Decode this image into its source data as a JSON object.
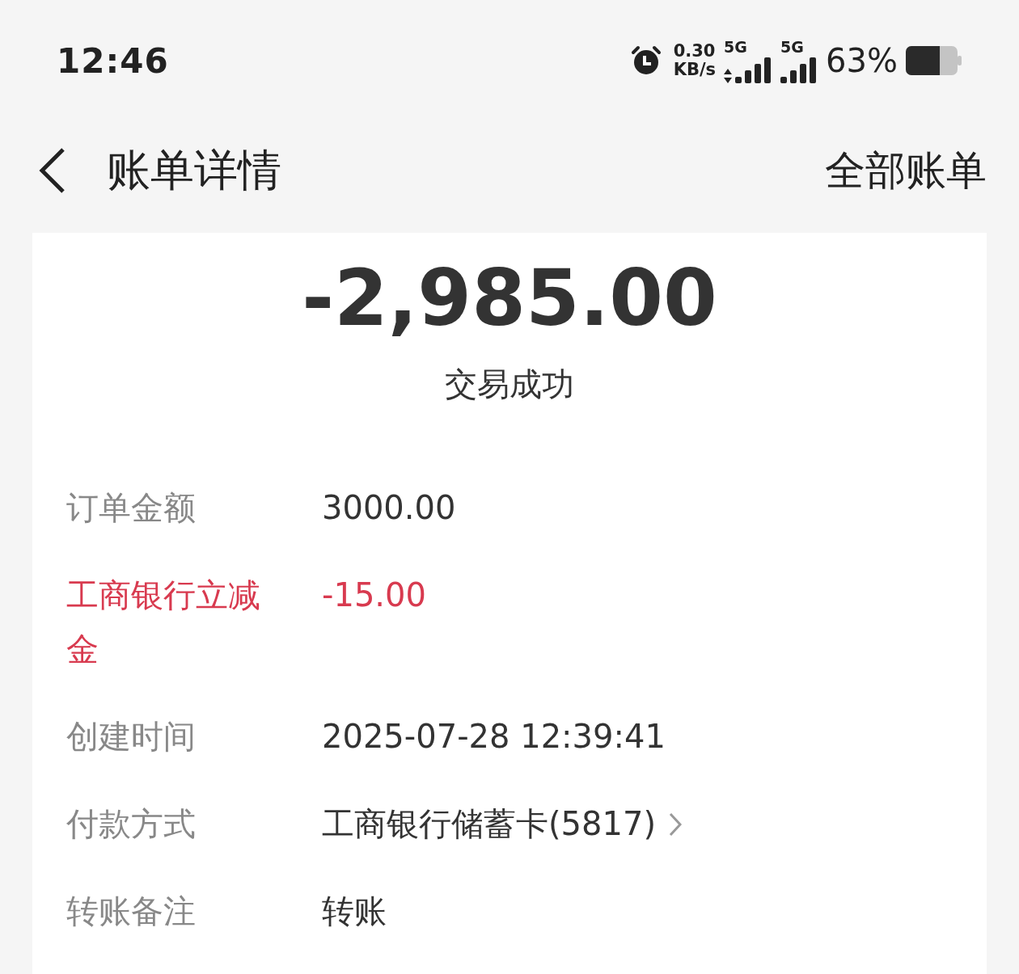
{
  "status_bar": {
    "time": "12:46",
    "net_speed": [
      "0.30",
      "KB/s"
    ],
    "network_labels": [
      "5G",
      "5G"
    ],
    "battery": "63%"
  },
  "header": {
    "title": "账单详情",
    "action": "全部账单"
  },
  "summary": {
    "amount": "-2,985.00",
    "status": "交易成功"
  },
  "details": [
    {
      "kind": "plain",
      "label": "订单金额",
      "value": "3000.00"
    },
    {
      "kind": "deduction",
      "label": "工商银行立减金",
      "value": "-15.00"
    },
    {
      "kind": "plain",
      "label": "创建时间",
      "value": "2025-07-28 12:39:41"
    },
    {
      "kind": "link",
      "label": "付款方式",
      "value": "工商银行储蓄卡(5817)"
    },
    {
      "kind": "plain",
      "label": "转账备注",
      "value": "转账"
    }
  ]
}
